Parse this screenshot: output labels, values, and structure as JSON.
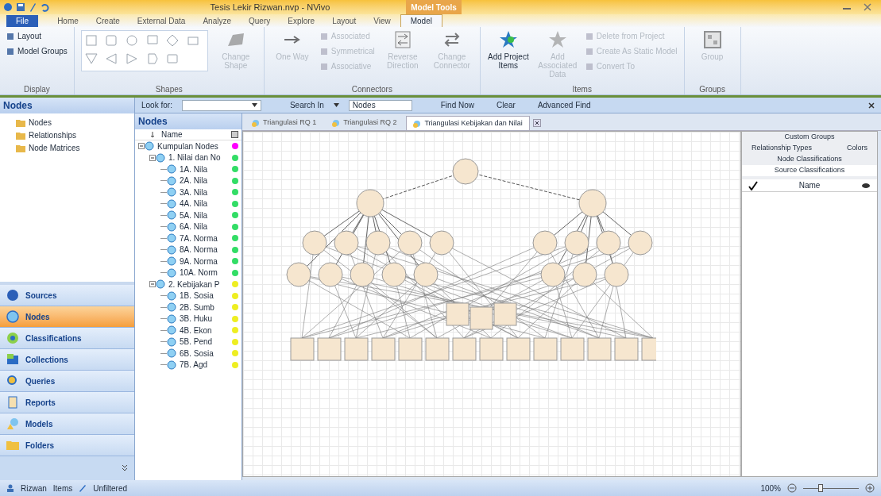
{
  "window": {
    "title": "Tesis Lekir Rizwan.nvp - NVivo",
    "context_tab": "Model Tools"
  },
  "ribbon_tabs": [
    {
      "label": "File",
      "selected": false,
      "kind": "file"
    },
    {
      "label": "Home",
      "selected": false
    },
    {
      "label": "Create",
      "selected": false
    },
    {
      "label": "External Data",
      "selected": false
    },
    {
      "label": "Analyze",
      "selected": false
    },
    {
      "label": "Query",
      "selected": false
    },
    {
      "label": "Explore",
      "selected": false
    },
    {
      "label": "Layout",
      "selected": false
    },
    {
      "label": "View",
      "selected": false
    },
    {
      "label": "Model",
      "selected": true
    }
  ],
  "ribbon_groups": [
    {
      "label": "Display",
      "controls": [
        {
          "kind": "small",
          "label": "Layout",
          "disabled": false
        },
        {
          "kind": "small",
          "label": "Model Groups",
          "disabled": false
        }
      ]
    },
    {
      "label": "Shapes",
      "controls": [
        {
          "kind": "gallery"
        },
        {
          "kind": "large",
          "label": "Change Shape",
          "disabled": true
        }
      ]
    },
    {
      "label": "Connectors",
      "controls": [
        {
          "kind": "large",
          "label": "One Way",
          "disabled": true
        },
        {
          "kind": "small",
          "label": "Associated",
          "disabled": true
        },
        {
          "kind": "small",
          "label": "Symmetrical",
          "disabled": true
        },
        {
          "kind": "small",
          "label": "Associative",
          "disabled": true
        },
        {
          "kind": "large",
          "label": "Reverse Direction",
          "disabled": true
        },
        {
          "kind": "large",
          "label": "Change Connector",
          "disabled": true
        }
      ]
    },
    {
      "label": "Items",
      "controls": [
        {
          "kind": "large",
          "label": "Add Project Items",
          "disabled": false
        },
        {
          "kind": "large",
          "label": "Add Associated Data",
          "disabled": true
        },
        {
          "kind": "small",
          "label": "Delete from Project",
          "disabled": true
        },
        {
          "kind": "small",
          "label": "Create As Static Model",
          "disabled": true
        },
        {
          "kind": "small",
          "label": "Convert To",
          "disabled": true
        }
      ]
    },
    {
      "label": "Groups",
      "controls": [
        {
          "kind": "large",
          "label": "Group",
          "disabled": true
        }
      ]
    }
  ],
  "find_bar": {
    "look_for_label": "Look for:",
    "search_in_label": "Search In",
    "search_in_value": "Nodes",
    "buttons": [
      "Find Now",
      "Clear",
      "Advanced Find"
    ]
  },
  "navigation": {
    "title": "Nodes",
    "folders": [
      {
        "label": "Nodes",
        "selected": false
      },
      {
        "label": "Relationships",
        "selected": false
      },
      {
        "label": "Node Matrices",
        "selected": false
      }
    ],
    "buttons": [
      {
        "label": "Sources",
        "selected": false
      },
      {
        "label": "Nodes",
        "selected": true
      },
      {
        "label": "Classifications",
        "selected": false
      },
      {
        "label": "Collections",
        "selected": false
      },
      {
        "label": "Queries",
        "selected": false
      },
      {
        "label": "Reports",
        "selected": false
      },
      {
        "label": "Models",
        "selected": false
      },
      {
        "label": "Folders",
        "selected": false
      }
    ]
  },
  "node_list": {
    "title": "Nodes",
    "column": "Name",
    "items": [
      {
        "label": "Kumpulan Nodes",
        "color": "#ff00ff",
        "expanded": true,
        "children": [
          {
            "label": "1. Nilai dan No",
            "color": "#33dd66",
            "expanded": true,
            "children": [
              {
                "label": "1A. Nila",
                "color": "#33dd66"
              },
              {
                "label": "2A. Nila",
                "color": "#33dd66"
              },
              {
                "label": "3A. Nila",
                "color": "#33dd66"
              },
              {
                "label": "4A. Nila",
                "color": "#33dd66"
              },
              {
                "label": "5A. Nila",
                "color": "#33dd66"
              },
              {
                "label": "6A. Nila",
                "color": "#33dd66"
              },
              {
                "label": "7A. Norma",
                "color": "#33dd66"
              },
              {
                "label": "8A. Norma",
                "color": "#33dd66"
              },
              {
                "label": "9A. Norma",
                "color": "#33dd66"
              },
              {
                "label": "10A. Norm",
                "color": "#33dd66"
              }
            ]
          },
          {
            "label": "2. Kebijakan P",
            "color": "#eeee22",
            "expanded": true,
            "children": [
              {
                "label": "1B. Sosia",
                "color": "#eeee22"
              },
              {
                "label": "2B. Sumb",
                "color": "#eeee22"
              },
              {
                "label": "3B. Huku",
                "color": "#eeee22"
              },
              {
                "label": "4B. Ekon",
                "color": "#eeee22"
              },
              {
                "label": "5B. Pend",
                "color": "#eeee22"
              },
              {
                "label": "6B. Sosia",
                "color": "#eeee22"
              },
              {
                "label": "7B. Agd",
                "color": "#eeee22"
              }
            ]
          }
        ]
      }
    ]
  },
  "doc_tabs": [
    {
      "label": "Triangulasi RQ 1",
      "selected": false,
      "closable": false
    },
    {
      "label": "Triangulasi RQ 2",
      "selected": false,
      "closable": false
    },
    {
      "label": "Triangulasi Kebijakan dan Nilai",
      "selected": true,
      "closable": true
    }
  ],
  "model_panel": {
    "groups": [
      {
        "label": "Custom Groups",
        "selected": false
      },
      {
        "label": "Relationship Types",
        "selected": false
      },
      {
        "label": "Colors",
        "selected": false
      },
      {
        "label": "Node Classifications",
        "selected": false
      },
      {
        "label": "Source Classifications",
        "selected": true
      }
    ],
    "column": "Name"
  },
  "status_bar": {
    "user": "Rizwan",
    "items": "Items",
    "state": "Unfiltered",
    "zoom": "100%",
    "zoom_level": {
      "level": 0.3
    }
  }
}
